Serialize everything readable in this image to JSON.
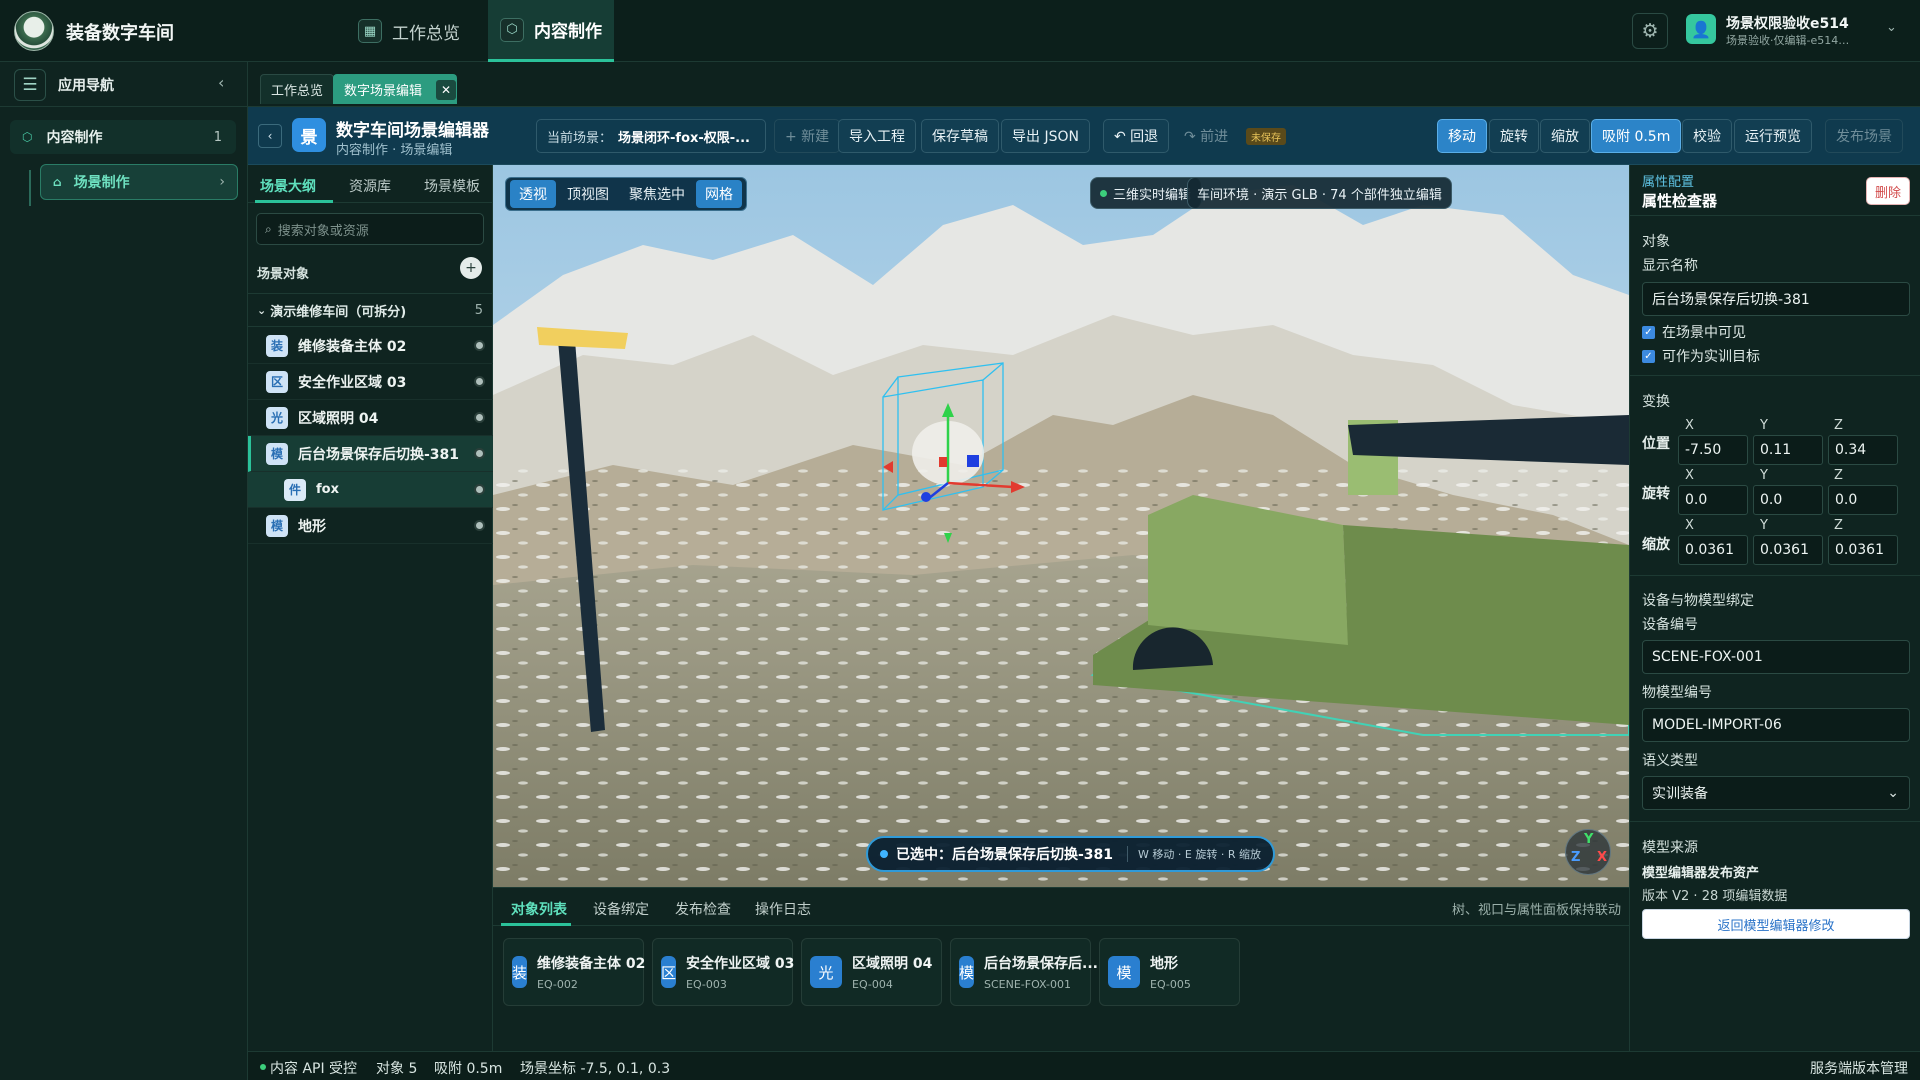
{
  "app": {
    "name": "装备数字车间"
  },
  "topnav": [
    {
      "label": "工作总览"
    },
    {
      "label": "内容制作"
    }
  ],
  "user": {
    "name": "场景权限验收e514",
    "role": "场景验收·仅编辑-e5145811..."
  },
  "sidebar": {
    "title": "应用导航",
    "section": {
      "label": "内容制作",
      "count": "1"
    },
    "item": {
      "label": "场景制作"
    }
  },
  "pagetabs": [
    {
      "label": "工作总览"
    },
    {
      "label": "数字场景编辑"
    }
  ],
  "editor": {
    "badge": "景",
    "title": "数字车间场景编辑器",
    "breadcrumb": "内容制作 · 场景编辑",
    "current_scene_label": "当前场景：",
    "current_scene_value": "场景闭环-fox-权限-...",
    "toolbar": {
      "new": "+ 新建",
      "import": "导入工程",
      "save_draft": "保存草稿",
      "export_json": "导出 JSON",
      "undo": "↶ 回退",
      "redo": "↷ 前进",
      "unsaved": "未保存",
      "move": "移动",
      "rotate": "旋转",
      "scale": "缩放",
      "snap": "吸附 0.5m",
      "validate": "校验",
      "preview": "运行预览",
      "publish": "发布场景"
    }
  },
  "outline": {
    "tabs": [
      "场景大纲",
      "资源库",
      "场景模板"
    ],
    "search_placeholder": "搜索对象或资源",
    "section_label": "场景对象",
    "group": {
      "label": "演示维修车间（可拆分)",
      "count": "5"
    },
    "items": [
      {
        "badge": "装",
        "label": "维修装备主体 02"
      },
      {
        "badge": "区",
        "label": "安全作业区域 03"
      },
      {
        "badge": "光",
        "label": "区域照明 04"
      },
      {
        "badge": "模",
        "label": "后台场景保存后切换-381"
      },
      {
        "badge": "件",
        "label": "fox"
      },
      {
        "badge": "模",
        "label": "地形"
      }
    ]
  },
  "viewport": {
    "tools": [
      "透视",
      "顶视图",
      "聚焦选中",
      "网格"
    ],
    "live_badge": "三维实时编辑",
    "env_badge": "车间环境 · 演示 GLB · 74 个部件独立编辑",
    "selected_label": "已选中：后台场景保存后切换-381",
    "hotkeys": "W 移动 · E 旋转 · R 缩放",
    "gizmo": {
      "y": "Y",
      "z": "Z",
      "x": "X"
    },
    "colors": {
      "sky": "#c8dceb",
      "selection": "#39b9ea",
      "axis_x": "#e23a2f",
      "axis_y": "#2fd24a",
      "axis_z": "#1f3fe0"
    }
  },
  "bottom": {
    "tabs": [
      "对象列表",
      "设备绑定",
      "发布检查",
      "操作日志"
    ],
    "note": "树、视口与属性面板保持联动",
    "cards": [
      {
        "badge": "装",
        "title": "维修装备主体 02",
        "code": "EQ-002"
      },
      {
        "badge": "区",
        "title": "安全作业区域 03",
        "code": "EQ-003"
      },
      {
        "badge": "光",
        "title": "区域照明 04",
        "code": "EQ-004"
      },
      {
        "badge": "模",
        "title": "后台场景保存后...",
        "code": "SCENE-FOX-001"
      },
      {
        "badge": "模",
        "title": "地形",
        "code": "EQ-005"
      }
    ]
  },
  "status": {
    "api": "内容 API 受控",
    "objects": "对象 5",
    "snap": "吸附 0.5m",
    "coords": "场景坐标 -7.5, 0.1, 0.3",
    "right": "服务端版本管理"
  },
  "props": {
    "title": "属性配置",
    "subtitle": "属性检查器",
    "delete": "删除",
    "object_section": "对象",
    "display_name_label": "显示名称",
    "display_name": "后台场景保存后切换-381",
    "visible": "在场景中可见",
    "trainable": "可作为实训目标",
    "transform_section": "变换",
    "axes": [
      "X",
      "Y",
      "Z"
    ],
    "position_label": "位置",
    "position": [
      "-7.50",
      "0.11",
      "0.34"
    ],
    "rotation_label": "旋转",
    "rotation": [
      "0.0",
      "0.0",
      "0.0"
    ],
    "scale_label": "缩放",
    "scale": [
      "0.0361",
      "0.0361",
      "0.0361"
    ],
    "binding_section": "设备与物模型绑定",
    "device_code_label": "设备编号",
    "device_code": "SCENE-FOX-001",
    "model_code_label": "物模型编号",
    "model_code": "MODEL-IMPORT-06",
    "semantic_label": "语义类型",
    "semantic_value": "实训装备",
    "source_section": "模型来源",
    "source_name": "模型编辑器发布资产",
    "source_version": "版本 V2 · 28 项编辑数据",
    "return_button": "返回模型编辑器修改"
  }
}
